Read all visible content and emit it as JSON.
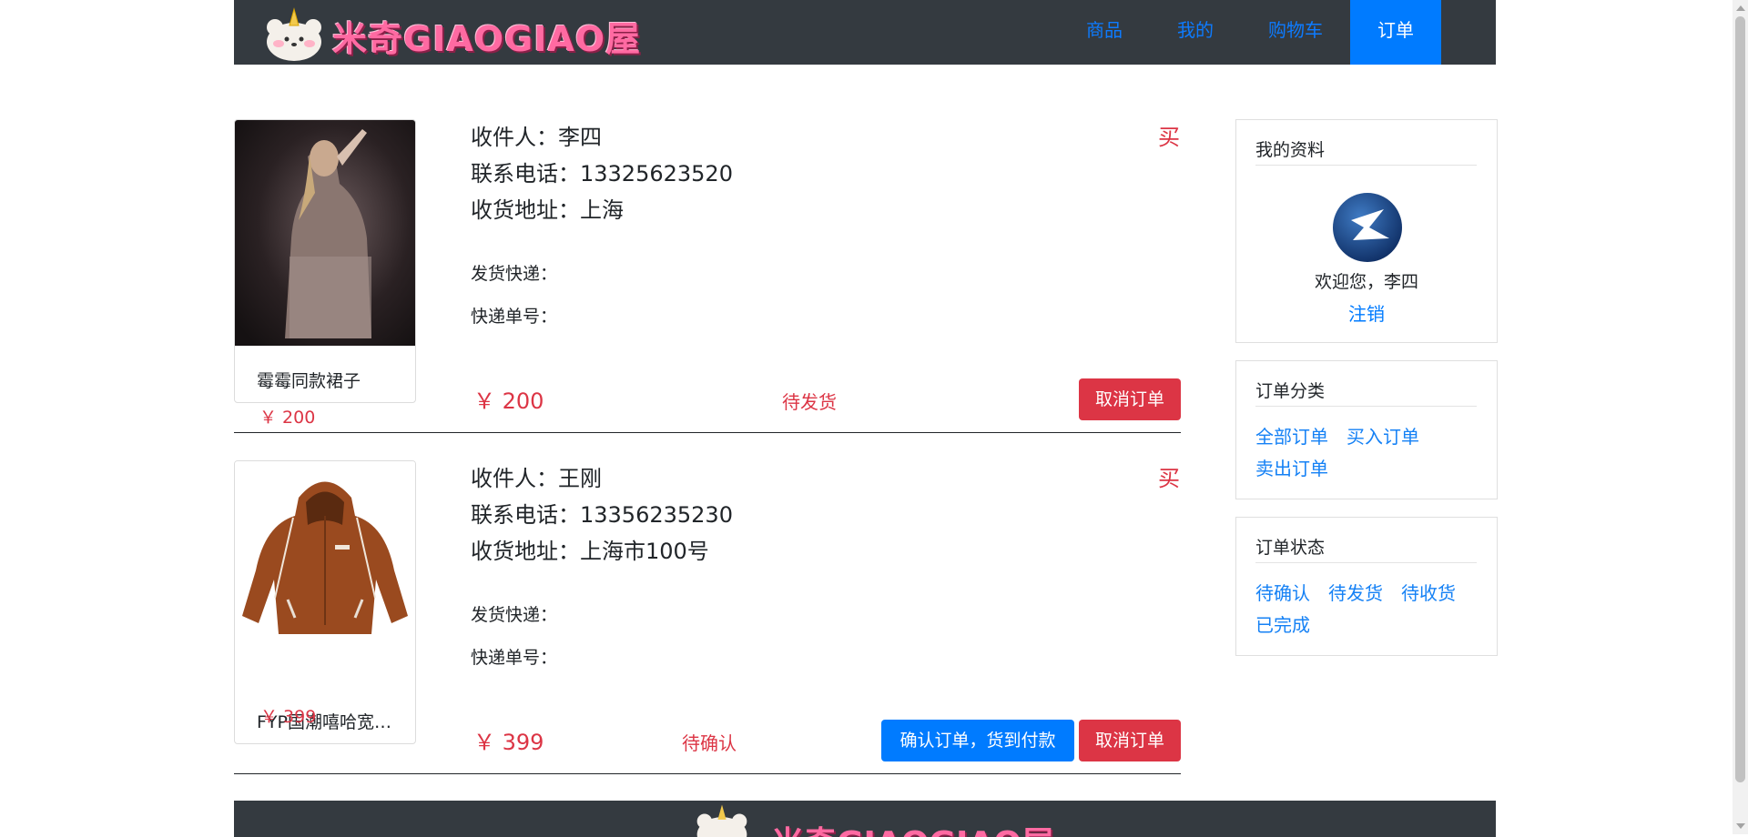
{
  "brand": {
    "logo_text": "米奇GIAOGIAO屋"
  },
  "nav": {
    "items": [
      {
        "label": "商品"
      },
      {
        "label": "我的"
      },
      {
        "label": "购物车"
      },
      {
        "label": "订单"
      }
    ],
    "active_index": 3
  },
  "orders": [
    {
      "product_name": "霉霉同款裙子",
      "product_price": "￥ 200",
      "recipient": "收件人：李四",
      "phone": "联系电话：13325623520",
      "address": "收货地址：上海",
      "courier_label": "发货快递：",
      "tracking_label": "快递单号：",
      "type_tag": "买",
      "price": "￥ 200",
      "status": "待发货",
      "cancel_label": "取消订单"
    },
    {
      "product_name": "FYP国潮嘻哈宽松冲锋衣",
      "product_price": "￥ 399",
      "recipient": "收件人：王刚",
      "phone": "联系电话：13356235230",
      "address": "收货地址：上海市100号",
      "courier_label": "发货快递：",
      "tracking_label": "快递单号：",
      "type_tag": "买",
      "price": "￥ 399",
      "status": "待确认",
      "confirm_label": "确认订单，货到付款",
      "cancel_label": "取消订单"
    }
  ],
  "sidebar": {
    "profile": {
      "title": "我的资料",
      "welcome": "欢迎您，李四",
      "logout": "注销"
    },
    "categories": {
      "title": "订单分类",
      "links": [
        "全部订单",
        "买入订单",
        "卖出订单"
      ]
    },
    "status": {
      "title": "订单状态",
      "links": [
        "待确认",
        "待发货",
        "待收货",
        "已完成"
      ]
    }
  },
  "colors": {
    "navbar_bg": "#343a40",
    "primary": "#007bff",
    "danger": "#dc3545",
    "logo_pink": "#ff6aa2"
  }
}
